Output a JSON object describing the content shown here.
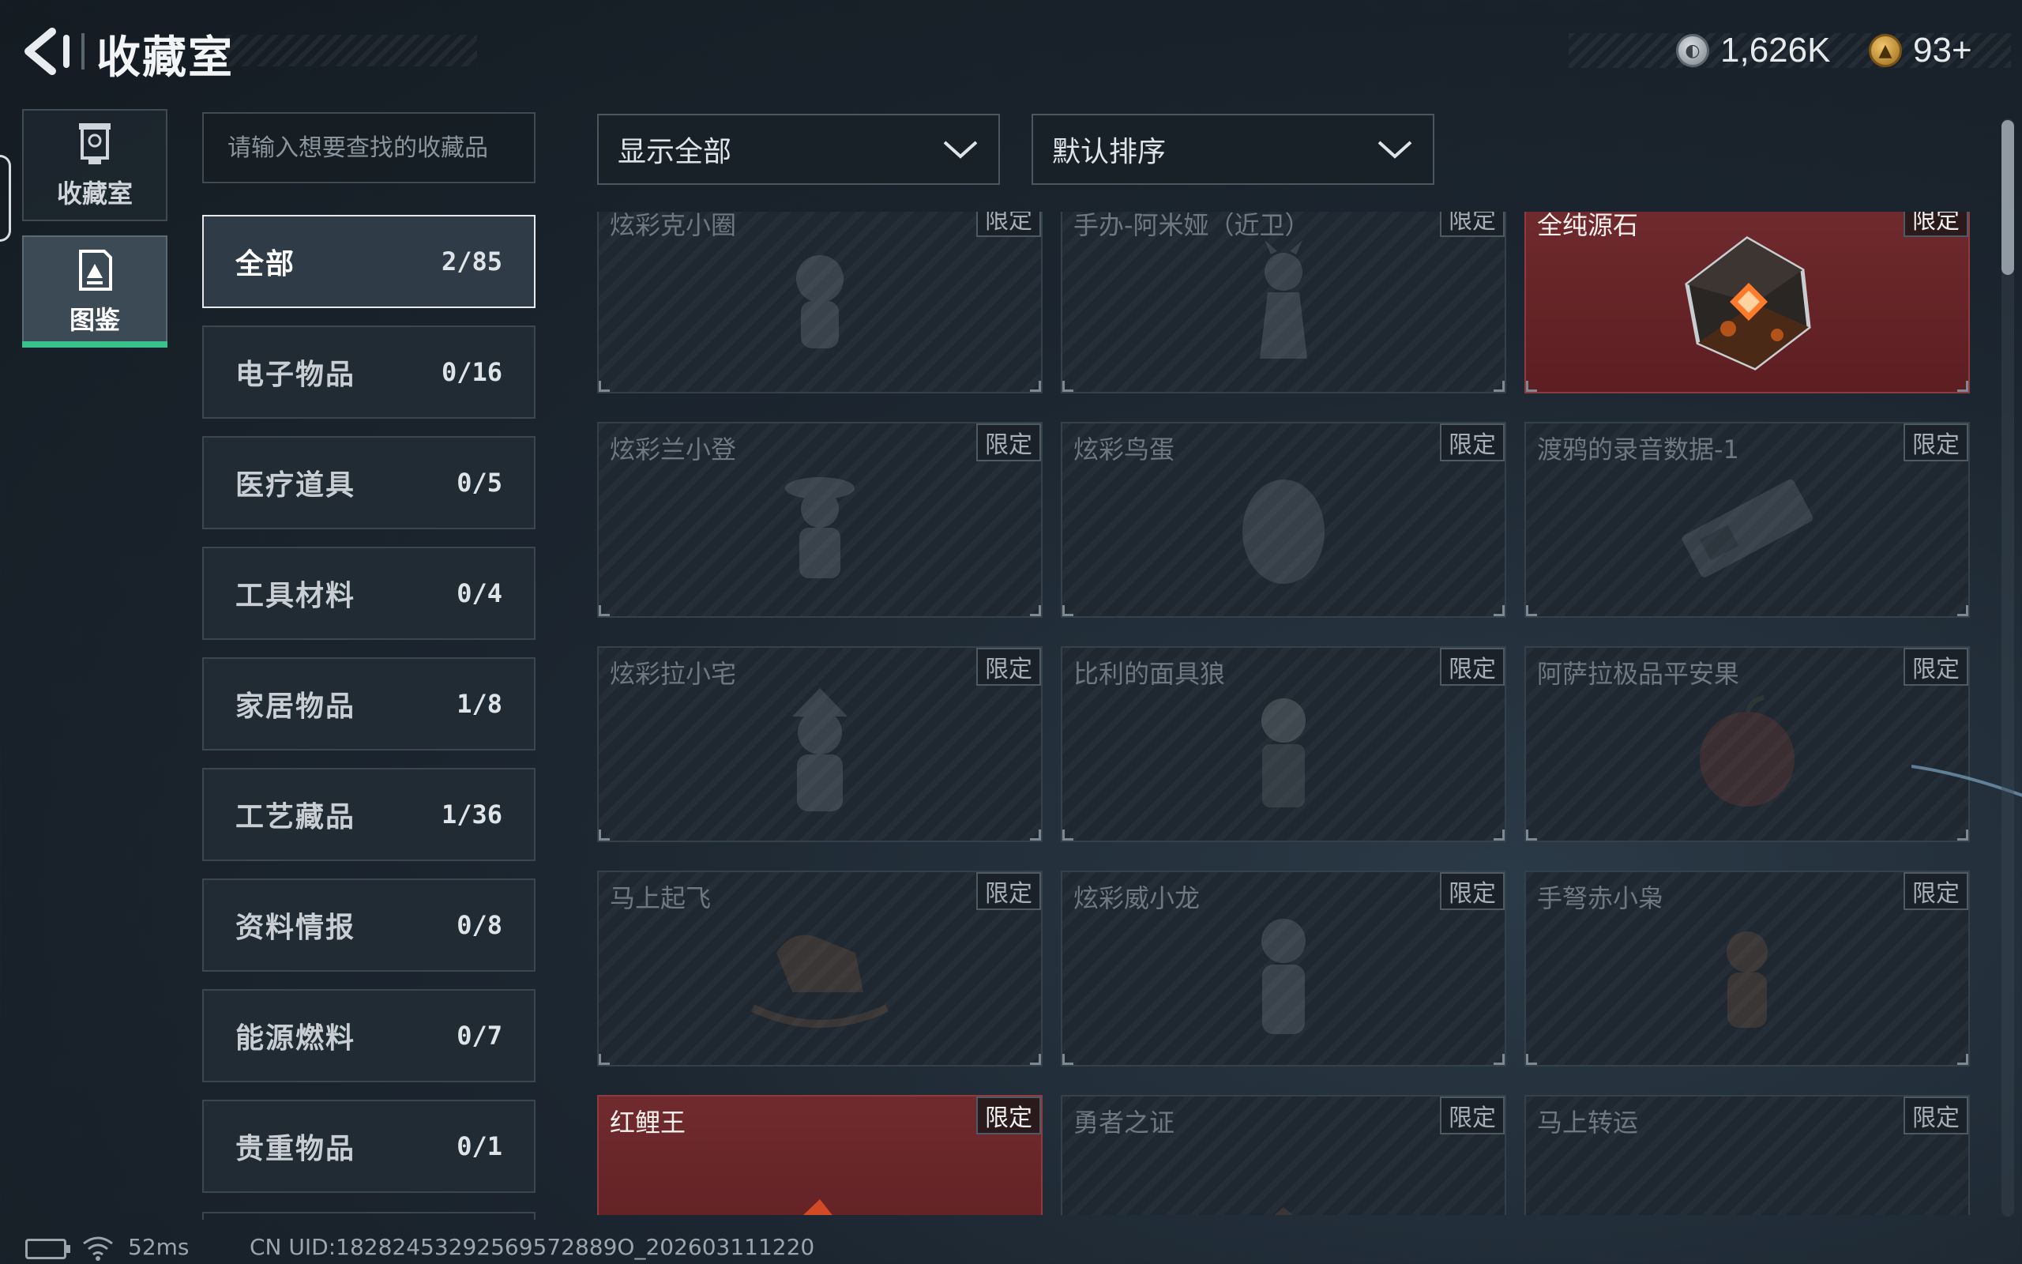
{
  "header": {
    "title": "收藏室",
    "currency_1": "1,626K",
    "currency_2": "93+"
  },
  "rail": {
    "tabs": [
      {
        "label": "收藏室",
        "active": false
      },
      {
        "label": "图鉴",
        "active": true
      }
    ]
  },
  "search": {
    "placeholder": "请输入想要查找的收藏品"
  },
  "categories": [
    {
      "name": "全部",
      "count": "2/85",
      "active": true
    },
    {
      "name": "电子物品",
      "count": "0/16"
    },
    {
      "name": "医疗道具",
      "count": "0/5"
    },
    {
      "name": "工具材料",
      "count": "0/4"
    },
    {
      "name": "家居物品",
      "count": "1/8"
    },
    {
      "name": "工艺藏品",
      "count": "1/36"
    },
    {
      "name": "资料情报",
      "count": "0/8"
    },
    {
      "name": "能源燃料",
      "count": "0/7"
    },
    {
      "name": "贵重物品",
      "count": "0/1"
    }
  ],
  "filters": {
    "display": "显示全部",
    "sort": "默认排序"
  },
  "items": [
    {
      "name": "炫彩克小圈",
      "tag": "限定",
      "owned": false,
      "icon": "figurine-icon"
    },
    {
      "name": "手办-阿米娅（近卫）",
      "tag": "限定",
      "owned": false,
      "icon": "figurine-icon"
    },
    {
      "name": "全纯源石",
      "tag": "限定",
      "owned": true,
      "icon": "originium-crystal-icon"
    },
    {
      "name": "炫彩兰小登",
      "tag": "限定",
      "owned": false,
      "icon": "figurine-icon"
    },
    {
      "name": "炫彩鸟蛋",
      "tag": "限定",
      "owned": false,
      "icon": "egg-icon"
    },
    {
      "name": "渡鸦的录音数据-1",
      "tag": "限定",
      "owned": false,
      "icon": "recorder-icon"
    },
    {
      "name": "炫彩拉小宅",
      "tag": "限定",
      "owned": false,
      "icon": "figurine-icon"
    },
    {
      "name": "比利的面具狼",
      "tag": "限定",
      "owned": false,
      "icon": "wolf-mask-icon"
    },
    {
      "name": "阿萨拉极品平安果",
      "tag": "限定",
      "owned": false,
      "icon": "apple-icon"
    },
    {
      "name": "马上起飞",
      "tag": "限定",
      "owned": false,
      "icon": "rocking-horse-icon"
    },
    {
      "name": "炫彩威小龙",
      "tag": "限定",
      "owned": false,
      "icon": "figurine-icon"
    },
    {
      "name": "手弩赤小枭",
      "tag": "限定",
      "owned": false,
      "icon": "owl-figure-icon"
    },
    {
      "name": "红鲤王",
      "tag": "限定",
      "owned": true,
      "icon": "red-carp-icon"
    },
    {
      "name": "勇者之证",
      "tag": "限定",
      "owned": false,
      "icon": "badge-icon"
    },
    {
      "name": "马上转运",
      "tag": "限定",
      "owned": false,
      "icon": "coin-icon"
    }
  ],
  "status": {
    "latency": "52ms",
    "uid": "CN UID:18282453292569572889O_202603111220"
  },
  "colors": {
    "owned_card": "#6a2226",
    "active_tab_accent": "#3ac08a",
    "background": "#1c2630"
  }
}
